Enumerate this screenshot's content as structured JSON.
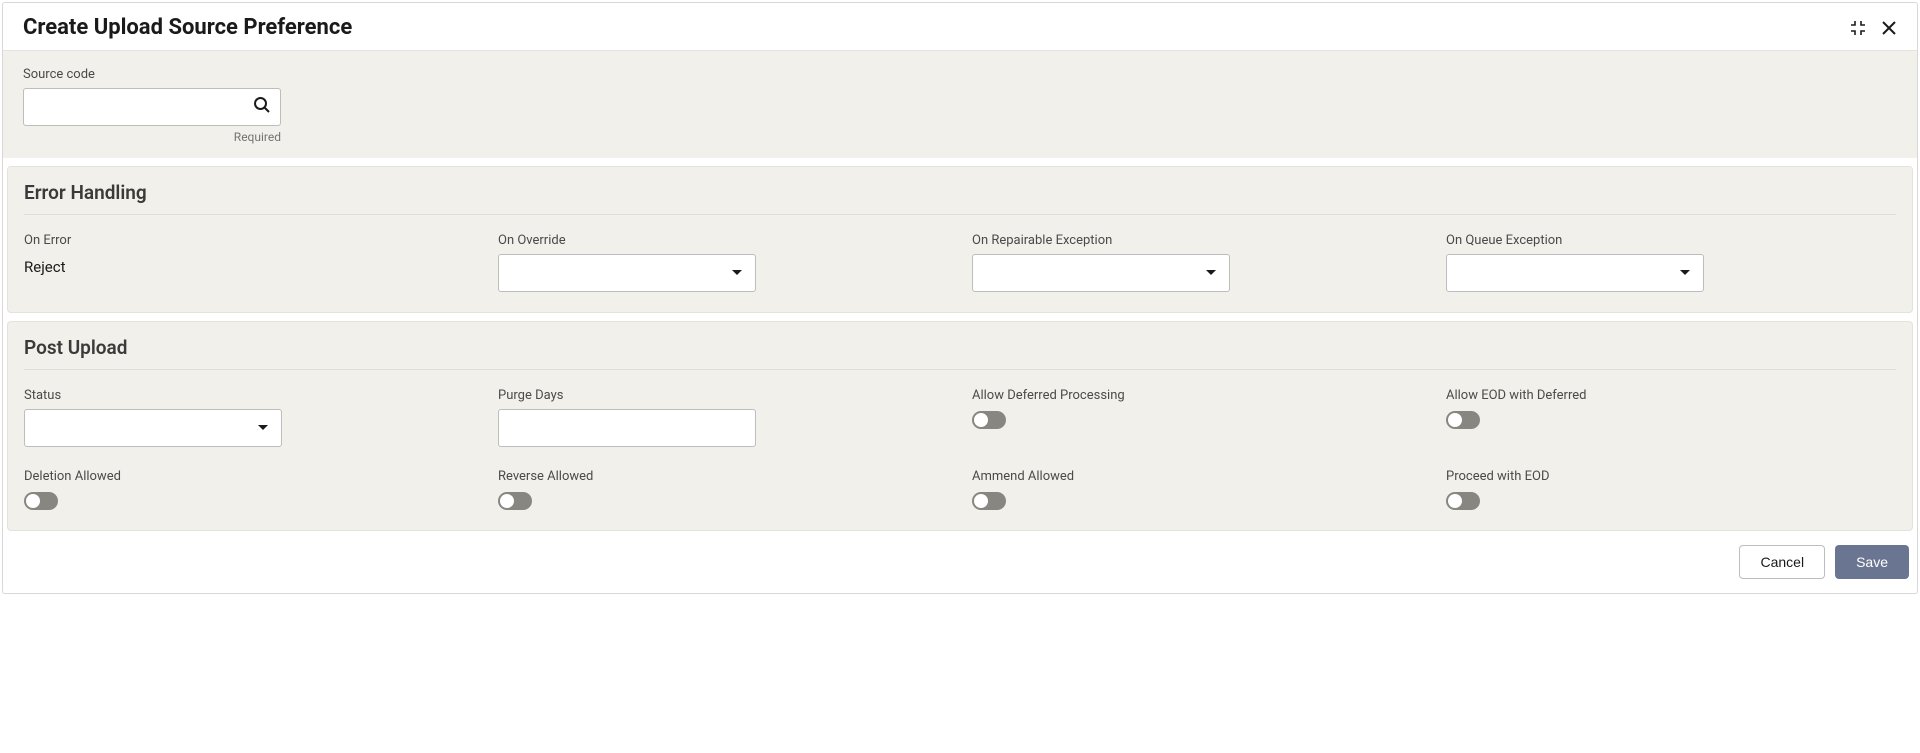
{
  "title": "Create Upload Source Preference",
  "sourceCode": {
    "label": "Source code",
    "value": "",
    "helper": "Required"
  },
  "errorHandling": {
    "heading": "Error Handling",
    "onError": {
      "label": "On Error",
      "value": "Reject"
    },
    "onOverride": {
      "label": "On Override",
      "value": ""
    },
    "onRepairableException": {
      "label": "On Repairable Exception",
      "value": ""
    },
    "onQueueException": {
      "label": "On Queue Exception",
      "value": ""
    }
  },
  "postUpload": {
    "heading": "Post Upload",
    "status": {
      "label": "Status",
      "value": ""
    },
    "purgeDays": {
      "label": "Purge Days",
      "value": ""
    },
    "allowDeferred": {
      "label": "Allow Deferred Processing",
      "on": false
    },
    "allowEOD": {
      "label": "Allow EOD with Deferred",
      "on": false
    },
    "deletionAllowed": {
      "label": "Deletion Allowed",
      "on": false
    },
    "reverseAllowed": {
      "label": "Reverse Allowed",
      "on": false
    },
    "ammendAllowed": {
      "label": "Ammend Allowed",
      "on": false
    },
    "proceedEOD": {
      "label": "Proceed with EOD",
      "on": false
    }
  },
  "footer": {
    "cancel": "Cancel",
    "save": "Save"
  }
}
